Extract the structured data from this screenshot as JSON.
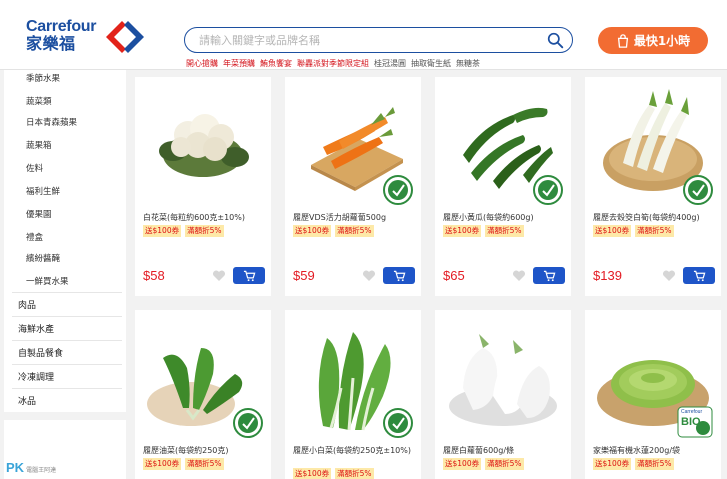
{
  "header": {
    "logo_en": "Carrefour",
    "logo_zh": "家樂福",
    "search_placeholder": "請輸入關鍵字或品牌名稱",
    "fast_button": "最快1小時",
    "hot_keywords": [
      {
        "text": "開心搶購",
        "color": "red"
      },
      {
        "text": "年菜預購",
        "color": "red"
      },
      {
        "text": "鮪魚饗宴",
        "color": "red"
      },
      {
        "text": "聯轟派對季節限定組",
        "color": "red"
      },
      {
        "text": "桂冠湯圓",
        "color": "gray"
      },
      {
        "text": "抽取衛生紙",
        "color": "gray"
      },
      {
        "text": "無糖茶",
        "color": "gray"
      }
    ]
  },
  "sidebar": {
    "sub_items": [
      "季節水果",
      "蔬菜類",
      "日本青森蘋果",
      "蔬果箱",
      "佐料",
      "福利生鮮",
      "優果園",
      "禮盒",
      "繽紛醬醃",
      "一鮮買水果"
    ],
    "main_items": [
      "肉品",
      "海鮮水產",
      "自製品餐食",
      "冷凍調理",
      "冰品"
    ]
  },
  "products": [
    {
      "name": "白花菜(每粒約600克±10%)",
      "tag1": "送$100券",
      "tag2": "滿額折5%",
      "price": "$58",
      "image": "cauliflower",
      "badge": "none"
    },
    {
      "name": "履歷VDS活力胡蘿蔔500g",
      "tag1": "送$100券",
      "tag2": "滿額折5%",
      "price": "$59",
      "image": "carrot",
      "badge": "green"
    },
    {
      "name": "履歷小黃瓜(每袋約600g)",
      "tag1": "送$100券",
      "tag2": "滿額折5%",
      "price": "$65",
      "image": "cucumber",
      "badge": "green"
    },
    {
      "name": "履歷去殼筊白筍(每袋約400g)",
      "tag1": "送$100券",
      "tag2": "滿額折5%",
      "price": "$139",
      "image": "bamboo",
      "badge": "green"
    },
    {
      "name": "履歷油菜(每袋約250克)",
      "tag1": "送$100券",
      "tag2": "滿額折5%",
      "price": "",
      "image": "greens",
      "badge": "green"
    },
    {
      "name": "履歷小白菜(每袋約250克±10%)",
      "tag1": "送$100券",
      "tag2": "滿額折5%",
      "price": "",
      "image": "bokchoy",
      "badge": "green"
    },
    {
      "name": "履歷白蘿蔔600g/條",
      "tag1": "送$100券",
      "tag2": "滿額折5%",
      "price": "",
      "image": "radish",
      "badge": "none"
    },
    {
      "name": "家樂福有機水蓮200g/袋",
      "tag1": "送$100券",
      "tag2": "滿額折5%",
      "price": "",
      "image": "waterlily",
      "badge": "bio"
    }
  ],
  "badge_bio_text": "BIO",
  "badge_bio_brand": "Carrefour",
  "watermark": "PK",
  "watermark_small": "電腦王阿達",
  "colors": {
    "brand_blue": "#1c4fa0",
    "accent_orange": "#f26c32",
    "price_red": "#e31b23",
    "cart_blue": "#1e55c8"
  }
}
